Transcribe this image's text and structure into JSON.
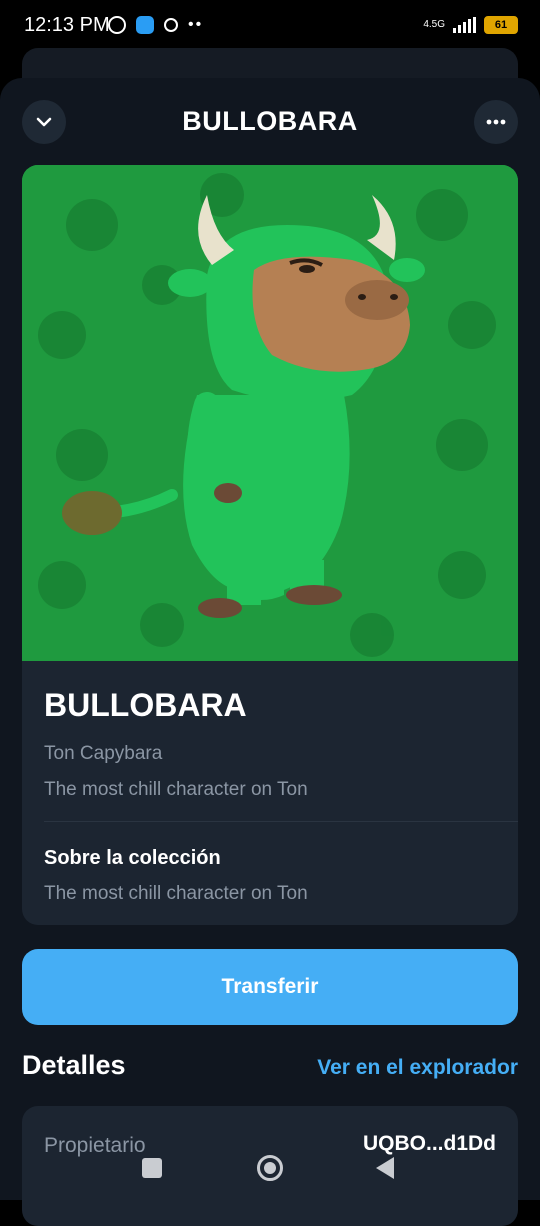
{
  "status_bar": {
    "time": "12:13 PM",
    "network": "4.5G",
    "battery": "61"
  },
  "header": {
    "title": "BULLOBARA",
    "collapse_icon": "chevron-down-icon",
    "more_icon": "more-horizontal-icon"
  },
  "nft": {
    "name": "BULLOBARA",
    "collection": "Ton Capybara",
    "description": "The most chill character on Ton",
    "about_title": "Sobre la colección",
    "about_description": "The most chill character on Ton"
  },
  "actions": {
    "transfer_label": "Transferir"
  },
  "details": {
    "title": "Detalles",
    "explorer_link": "Ver en el explorador",
    "owner_label": "Propietario",
    "owner_value": "UQBO...d1Dd"
  },
  "nav": {
    "recents_icon": "square-icon",
    "home_icon": "circle-icon",
    "back_icon": "triangle-back-icon"
  },
  "colors": {
    "accent": "#45aef5",
    "background": "#10161f",
    "card": "#1c2531",
    "art_green": "#1f9a3f"
  }
}
